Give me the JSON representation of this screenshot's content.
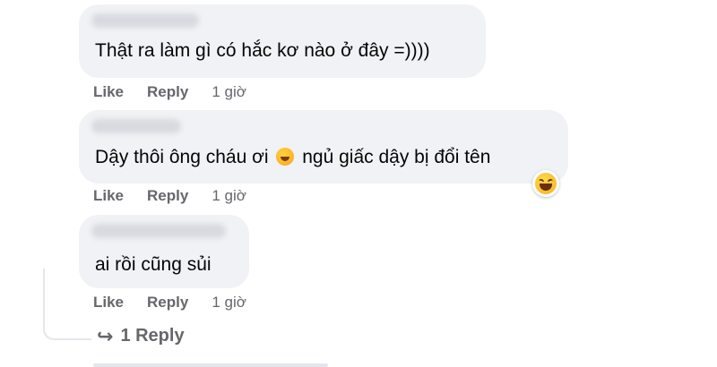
{
  "comments": [
    {
      "text": "Thật ra làm gì có hắc kơ nào ở đây =))))",
      "actions": {
        "like": "Like",
        "reply": "Reply",
        "time": "1 giờ"
      }
    },
    {
      "text_before": "Dậy thôi ông cháu ơi",
      "text_after": "ngủ giấc dậy bị đổi tên",
      "inline_emoji": "rolling-laughing-emoji",
      "reaction": "laughing-reaction",
      "actions": {
        "like": "Like",
        "reply": "Reply",
        "time": "1 giờ"
      }
    },
    {
      "text": "ai rồi cũng sủi",
      "actions": {
        "like": "Like",
        "reply": "Reply",
        "time": "1 giờ"
      }
    }
  ],
  "replies_link": "1 Reply",
  "colors": {
    "bubble": "#f0f2f5",
    "meta": "#65676b",
    "text": "#050505"
  }
}
